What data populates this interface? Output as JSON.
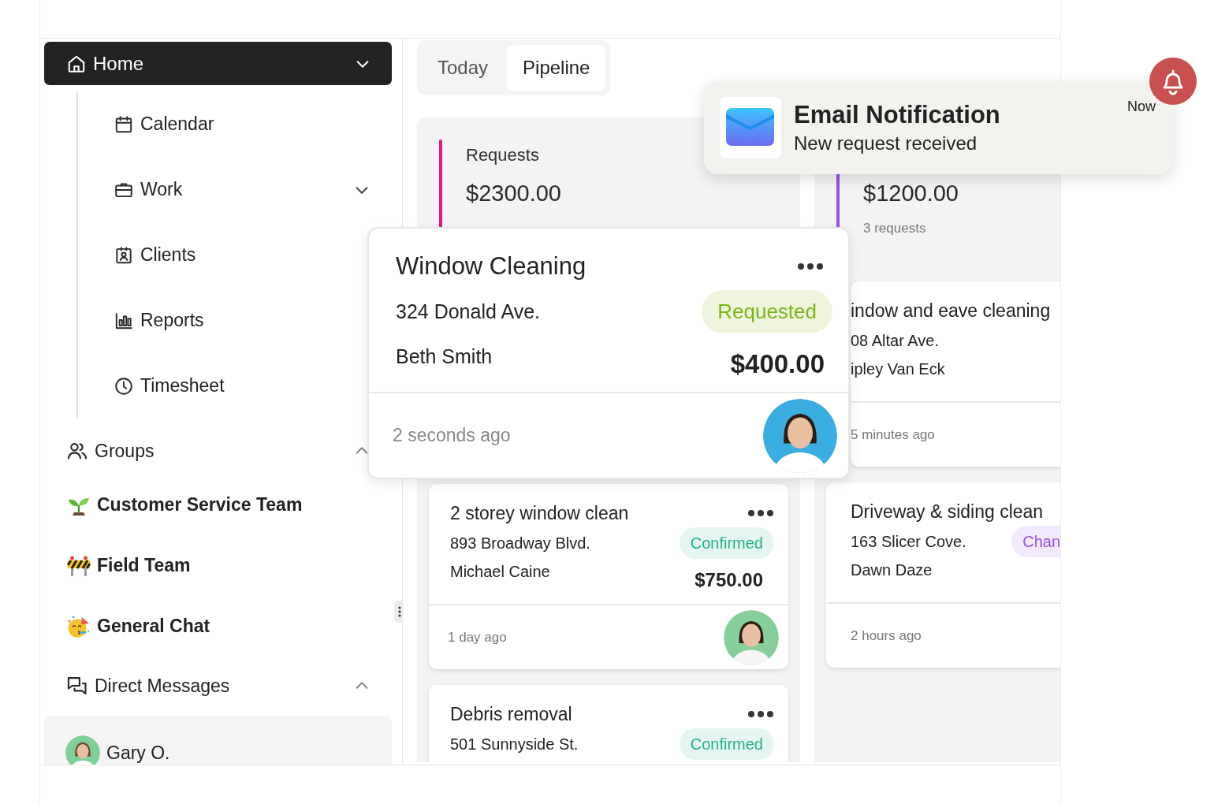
{
  "sidebar": {
    "home": {
      "label": "Home",
      "selected": true,
      "children": [
        {
          "label": "Calendar"
        },
        {
          "label": "Work",
          "expanded": false
        },
        {
          "label": "Clients"
        },
        {
          "label": "Reports"
        },
        {
          "label": "Timesheet"
        }
      ]
    },
    "groups": {
      "label": "Groups",
      "expanded": true,
      "channels": [
        {
          "label": "Customer Service Team",
          "kind": "seedling"
        },
        {
          "label": "Field Team",
          "kind": "barrier"
        },
        {
          "label": "General Chat",
          "kind": "party"
        }
      ]
    },
    "direct_messages": {
      "label": "Direct Messages",
      "expanded": true,
      "people": [
        {
          "name": "Gary O.",
          "selected": true
        }
      ]
    }
  },
  "view_tabs": [
    {
      "label": "Today",
      "selected": false
    },
    {
      "label": "Pipeline",
      "selected": true
    }
  ],
  "pipeline": {
    "columns": [
      {
        "title": "Requests",
        "color": "#e8197a",
        "total": "$2300.00",
        "dragged_card": {
          "title": "Window Cleaning",
          "address": "324 Donald Ave.",
          "client": "Beth Smith",
          "status": {
            "label": "Requested",
            "kind": "requested"
          },
          "amount": "$400.00",
          "time": "2 seconds ago",
          "avatar": true,
          "menu": true
        },
        "cards": [
          {
            "title": "2 storey window clean",
            "address": "893 Broadway Blvd.",
            "client": "Michael Caine",
            "status": {
              "label": "Confirmed",
              "kind": "confirmed"
            },
            "amount": "$750.00",
            "time": "1 day ago",
            "avatar": true,
            "menu": true
          },
          {
            "title": "Debris removal",
            "address": "501 Sunnyside St.",
            "status": {
              "label": "Confirmed",
              "kind": "confirmed"
            },
            "menu": true
          }
        ]
      },
      {
        "color": "#9b51e0",
        "total": "$1200.00",
        "count": "3 requests",
        "cards": [
          {
            "title": "indow and eave cleaning",
            "address": "08 Altar Ave.",
            "client": "ipley Van Eck",
            "time": "5 minutes ago"
          },
          {
            "title": "Driveway & siding clean",
            "address": "163 Slicer Cove.",
            "client": "Dawn Daze",
            "status": {
              "label": "Chan",
              "kind": "changes"
            },
            "time": "2 hours ago"
          }
        ]
      }
    ]
  },
  "notification": {
    "title": "Email Notification",
    "message": "New request received",
    "time": "Now"
  }
}
